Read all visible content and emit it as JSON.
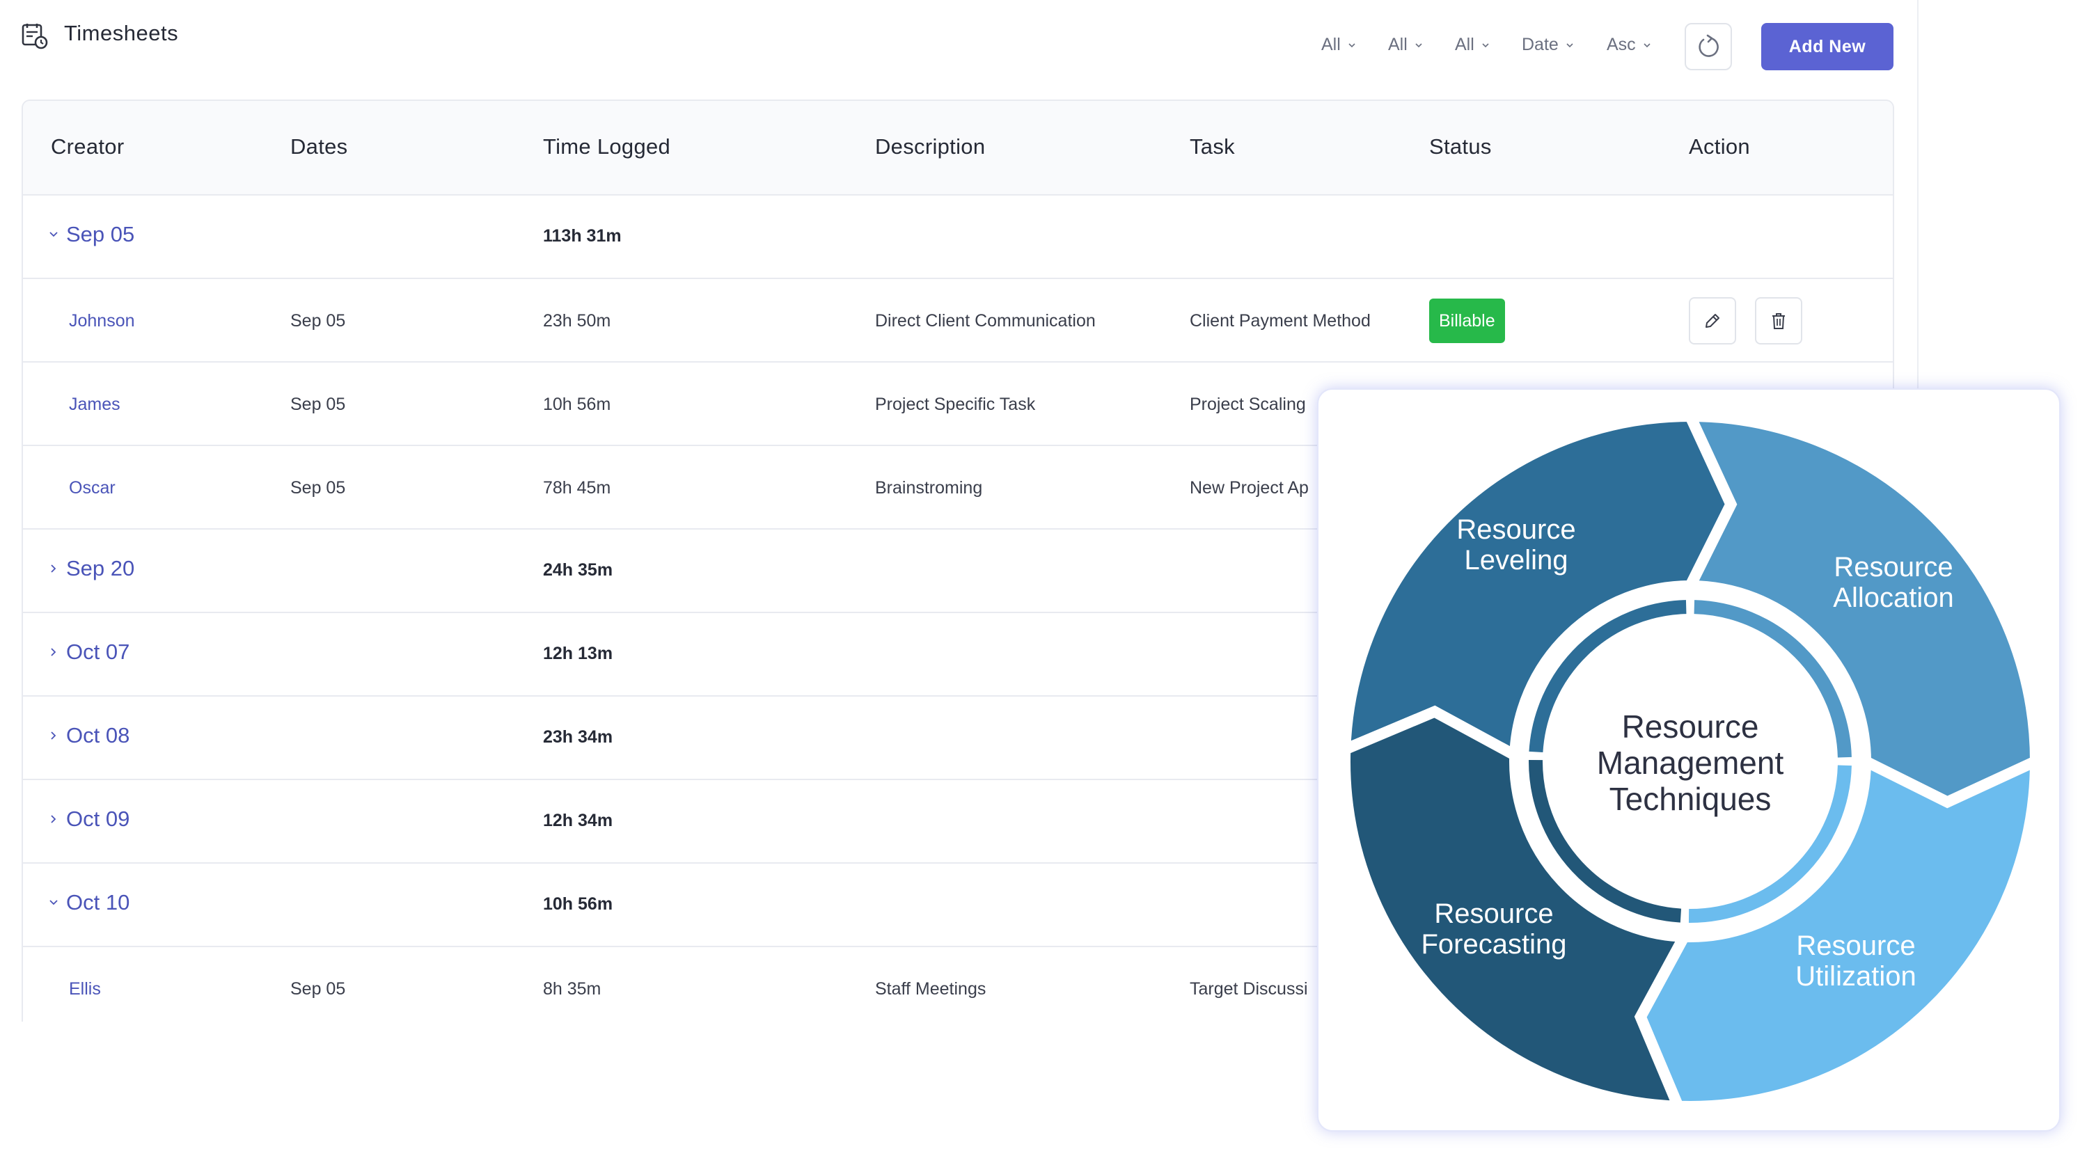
{
  "header": {
    "title": "Timesheets",
    "filters": [
      "All",
      "All",
      "All",
      "Date",
      "Asc"
    ],
    "add_label": "Add New"
  },
  "table": {
    "columns": [
      "Creator",
      "Dates",
      "Time Logged",
      "Description",
      "Task",
      "Status",
      "Action"
    ],
    "groups": [
      {
        "label": "Sep 05",
        "total": "113h 31m",
        "expanded": true,
        "rows": [
          {
            "creator": "Johnson",
            "date": "Sep 05",
            "time": "23h 50m",
            "description": "Direct Client Communication",
            "task": "Client Payment Method",
            "status": "Billable"
          },
          {
            "creator": "James",
            "date": "Sep 05",
            "time": "10h 56m",
            "description": "Project Specific Task",
            "task": "Project Scaling",
            "status": ""
          },
          {
            "creator": "Oscar",
            "date": "Sep 05",
            "time": "78h 45m",
            "description": "Brainstroming",
            "task": "New Project Ap",
            "status": ""
          }
        ]
      },
      {
        "label": "Sep 20",
        "total": "24h 35m",
        "expanded": false,
        "rows": []
      },
      {
        "label": "Oct 07",
        "total": "12h 13m",
        "expanded": false,
        "rows": []
      },
      {
        "label": "Oct 08",
        "total": "23h 34m",
        "expanded": false,
        "rows": []
      },
      {
        "label": "Oct 09",
        "total": "12h 34m",
        "expanded": false,
        "rows": []
      },
      {
        "label": "Oct 10",
        "total": "10h 56m",
        "expanded": true,
        "rows": [
          {
            "creator": "Ellis",
            "date": "Sep 05",
            "time": "8h 35m",
            "description": "Staff Meetings",
            "task": "Target Discussi",
            "status": ""
          }
        ]
      }
    ]
  },
  "diagram": {
    "center": [
      "Resource",
      "Management",
      "Techniques"
    ],
    "segments": [
      {
        "lines": [
          "Resource",
          "Leveling"
        ],
        "color": "#2d6e98"
      },
      {
        "lines": [
          "Resource",
          "Allocation"
        ],
        "color": "#5299c7"
      },
      {
        "lines": [
          "Resource",
          "Utilization"
        ],
        "color": "#6bbcee"
      },
      {
        "lines": [
          "Resource",
          "Forecasting"
        ],
        "color": "#225778"
      }
    ]
  },
  "colors": {
    "accent": "#5b63d3",
    "link": "#4a54b8",
    "billable": "#27b94a"
  }
}
